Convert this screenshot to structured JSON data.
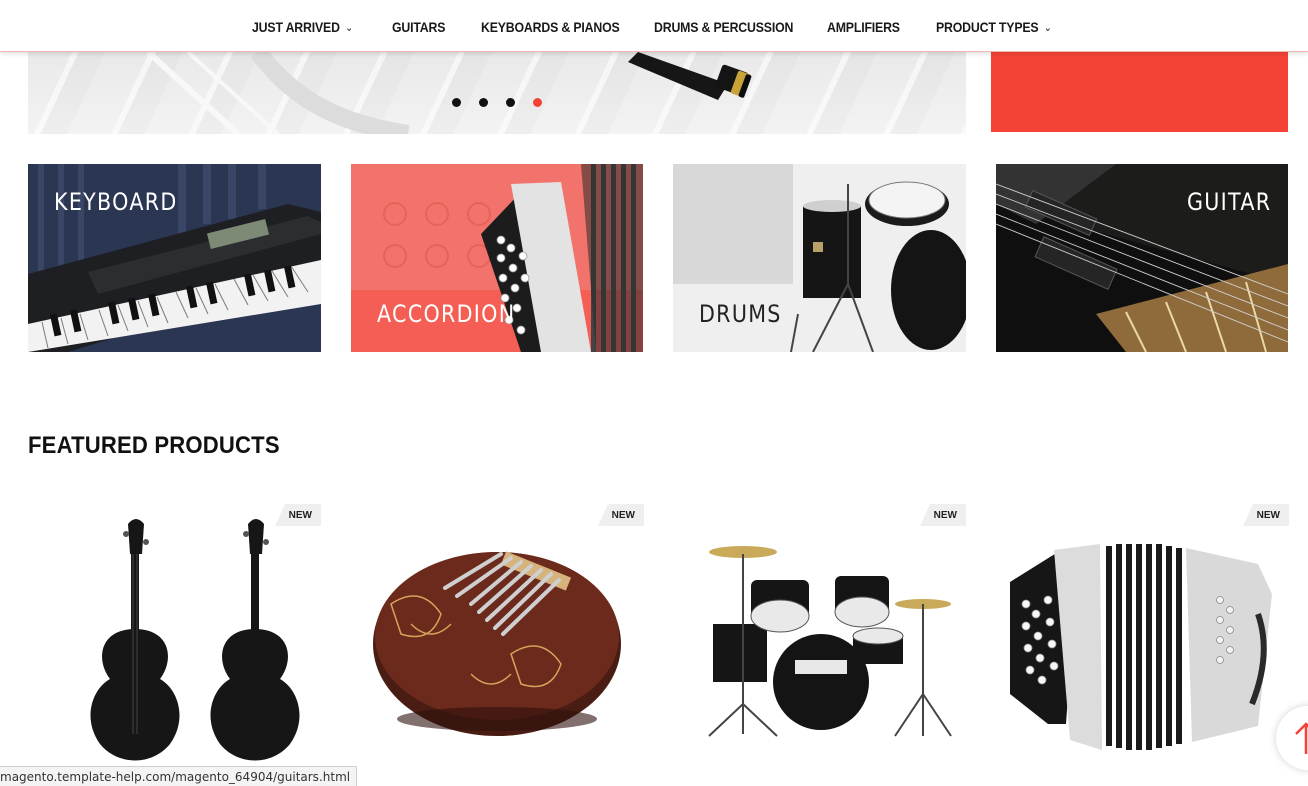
{
  "nav": {
    "items": [
      {
        "label": "JUST ARRIVED",
        "dropdown": true
      },
      {
        "label": "GUITARS",
        "dropdown": false
      },
      {
        "label": "KEYBOARDS & PIANOS",
        "dropdown": false
      },
      {
        "label": "DRUMS & PERCUSSION",
        "dropdown": false
      },
      {
        "label": "AMPLIFIERS",
        "dropdown": false
      },
      {
        "label": "PRODUCT TYPES",
        "dropdown": true
      }
    ],
    "chevron_icon": "chevron-down-icon"
  },
  "hero": {
    "slide_count": 4,
    "active_slide": 4
  },
  "categories": [
    {
      "label": "KEYBOARD"
    },
    {
      "label": "ACCORDION"
    },
    {
      "label": "DRUMS"
    },
    {
      "label": "GUITAR"
    }
  ],
  "featured": {
    "title": "FEATURED PRODUCTS",
    "products": [
      {
        "image": "violin",
        "badge": "NEW"
      },
      {
        "image": "kalimba",
        "badge": "NEW"
      },
      {
        "image": "drum-kit",
        "badge": "NEW"
      },
      {
        "image": "accordion",
        "badge": "NEW"
      }
    ]
  },
  "status_bar": {
    "url": "magento.template-help.com/magento_64904/guitars.html"
  },
  "colors": {
    "accent": "#f44336",
    "keyboard_tile": "#2a3550",
    "accordion_tile": "#f0746c",
    "text": "#111111"
  },
  "icons": {
    "scroll_top": "arrow-up-icon"
  }
}
